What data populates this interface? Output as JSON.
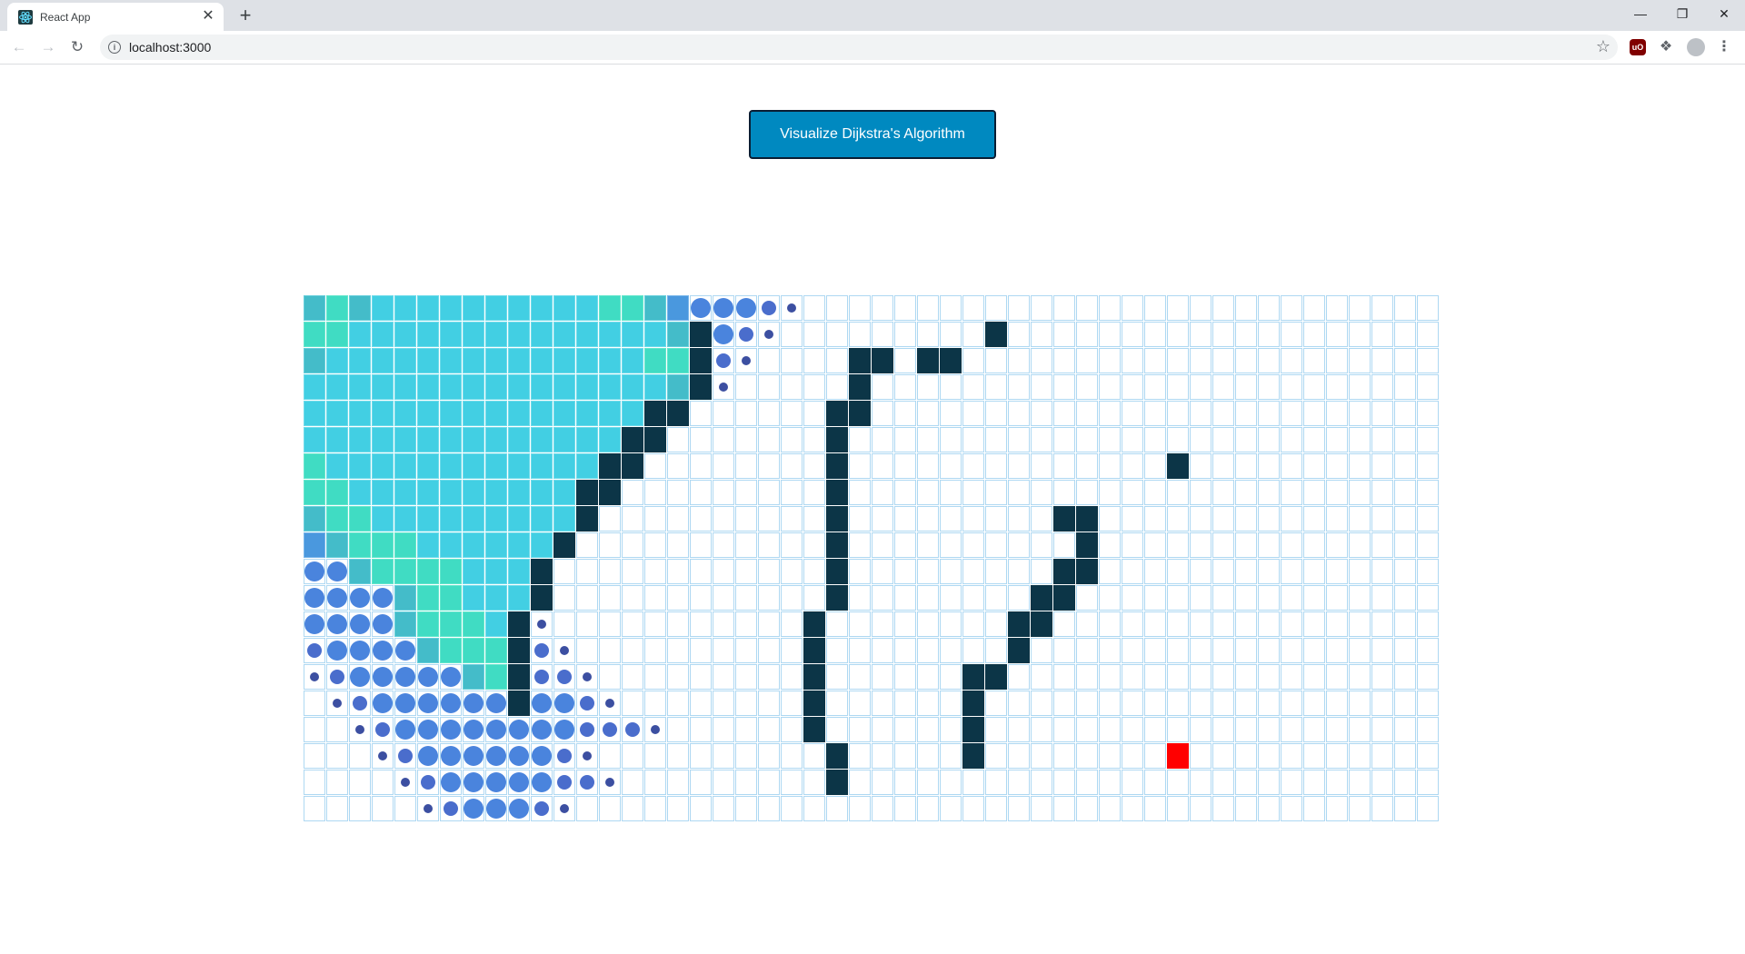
{
  "browser": {
    "tab_title": "React App",
    "tab_close_glyph": "✕",
    "new_tab_glyph": "+",
    "url": "localhost:3000",
    "icons": [
      "react-favicon",
      "back-arrow-icon",
      "forward-arrow-icon",
      "reload-icon",
      "info-icon",
      "star-icon",
      "ublock-icon",
      "puzzle-icon",
      "profile-icon",
      "kebab-menu-icon",
      "minimize-icon",
      "restore-icon",
      "close-icon"
    ]
  },
  "page": {
    "visualize_button_label": "Visualize Dijkstra's Algorithm"
  },
  "grid": {
    "rows": 20,
    "cols": 50,
    "legend": {
      ".": "unvisited",
      "W": "wall",
      "F": "finish node",
      "P": "visited (settled, cyan)",
      "G": "visited (settled, green)",
      "T": "visited (settled, teal)",
      "B": "visited (settled, blue)",
      "3": "visited (animating, large dot)",
      "2": "visited (animating, medium dot)",
      "1": "visited (animating, small dot)"
    },
    "cells": [
      "TGTPPPPPPPPPPGGTB33321............................",
      "GGPPPPPPPPPPPPPPTW321.........W...................",
      "TPPPPPPPPPPPPPPGGW21....WW.WW.....................",
      "PPPPPPPPPPPPPPPPTW1.....W.........................",
      "PPPPPPPPPPPPPPPWW......WW.........................",
      "PPPPPPPPPPPPPPWW.......W..........................",
      "GPPPPPPPPPPPPWW........W..............W...........",
      "GGPPPPPPPPPPWW.........W..........................",
      "TGGPPPPPPPPPW..........W.........WW...............",
      "BTGGGPPPPPPW...........W..........W...............",
      "33TGGGGPPPW............W.........WW...............",
      "3333TGGPPPW............W........WW................",
      "3333TGGGPW1...........W........WW.................",
      "23333TGGGW21..........W........W..................",
      "1233333TGW221.........W......WW...................",
      ".12333333W3321........W......W....................",
      "..12333333332221......W......W....................",
      "...1233333321..........W.....W........F...........",
      "....1233333221.........W..........................",
      ".....1233321......................................"
    ]
  }
}
